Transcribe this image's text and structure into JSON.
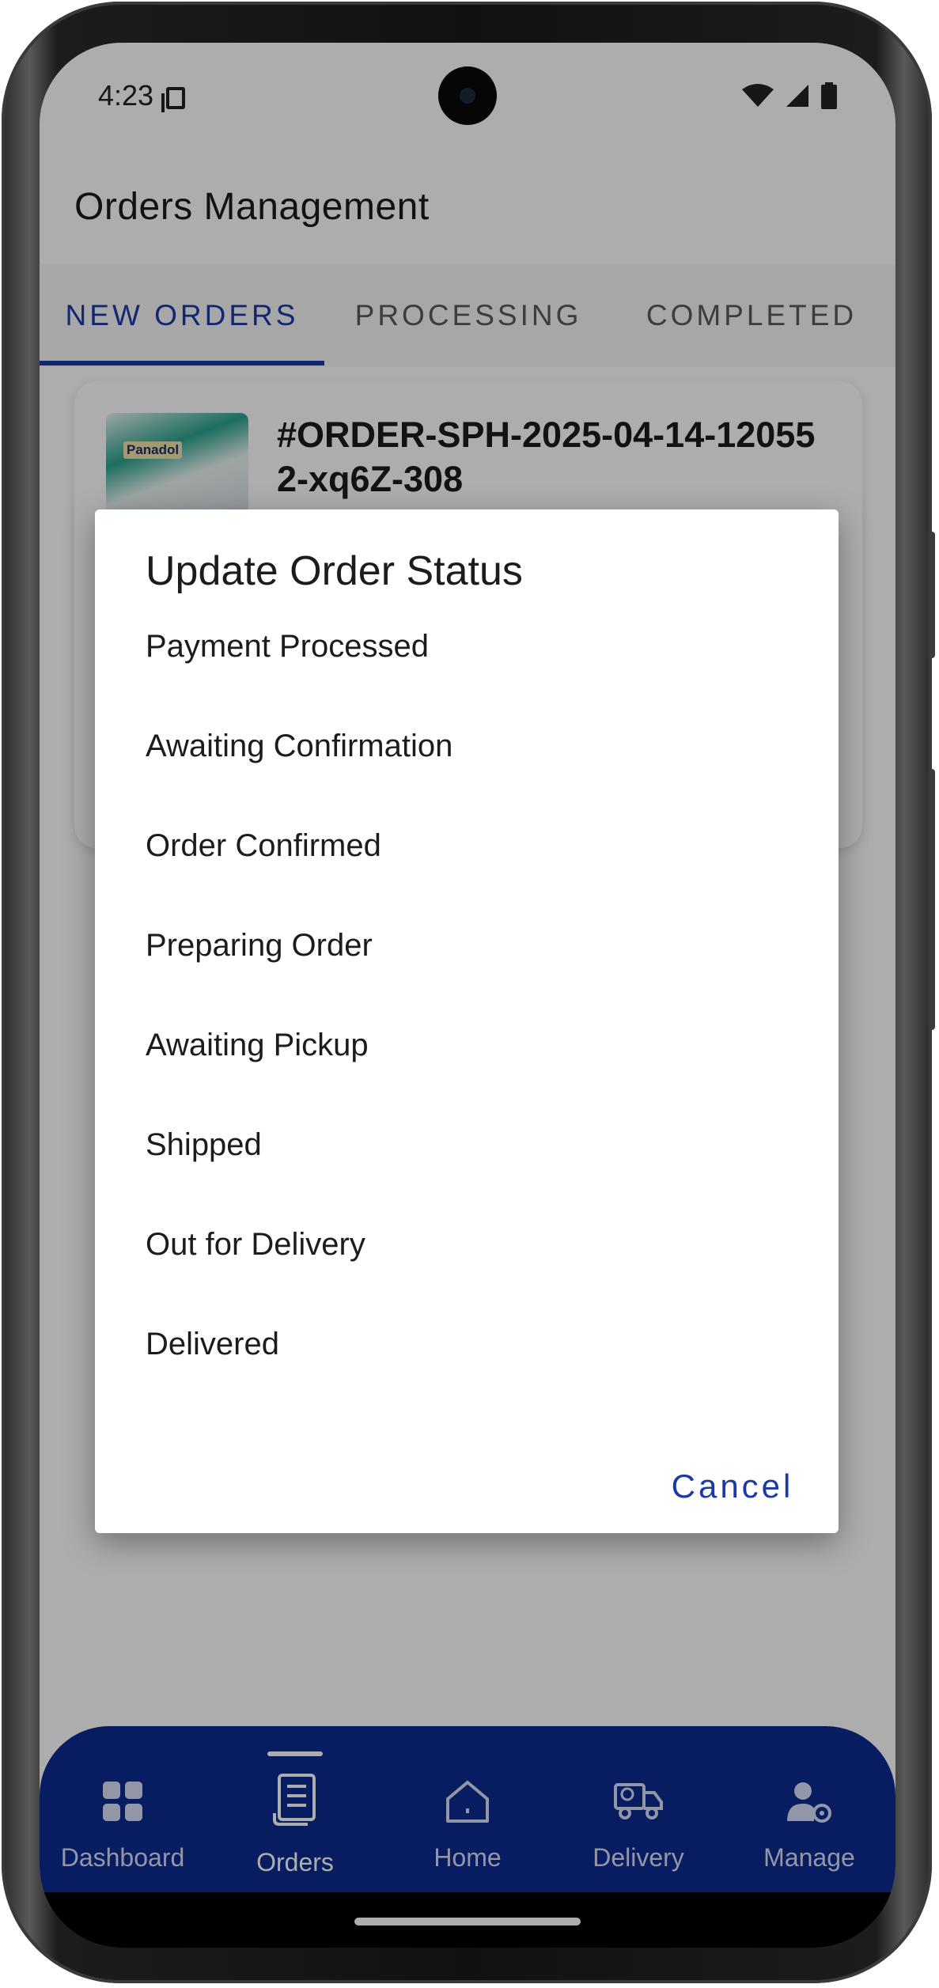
{
  "status_bar": {
    "time": "4:23"
  },
  "appbar": {
    "title": "Orders Management"
  },
  "tabs": [
    {
      "label": "NEW ORDERS",
      "active": true
    },
    {
      "label": "PROCESSING",
      "active": false
    },
    {
      "label": "COMPLETED",
      "active": false
    }
  ],
  "order": {
    "id": "#ORDER-SPH-2025-04-14-120552-xq6Z-308",
    "product_brand": "Panadol"
  },
  "dialog": {
    "title": "Update Order Status",
    "options": [
      "Payment Processed",
      "Awaiting Confirmation",
      "Order Confirmed",
      "Preparing Order",
      "Awaiting Pickup",
      "Shipped",
      "Out for Delivery",
      "Delivered"
    ],
    "cancel_label": "Cancel"
  },
  "bottom_nav": [
    {
      "label": "Dashboard",
      "icon": "dashboard-icon",
      "active": false
    },
    {
      "label": "Orders",
      "icon": "orders-icon",
      "active": true
    },
    {
      "label": "Home",
      "icon": "home-icon",
      "active": false
    },
    {
      "label": "Delivery",
      "icon": "delivery-icon",
      "active": false
    },
    {
      "label": "Manage",
      "icon": "manage-icon",
      "active": false
    }
  ],
  "colors": {
    "primary": "#1b3aa8",
    "nav_background": "#0d2c8f",
    "scrim": "rgba(0,0,0,0.32)"
  }
}
